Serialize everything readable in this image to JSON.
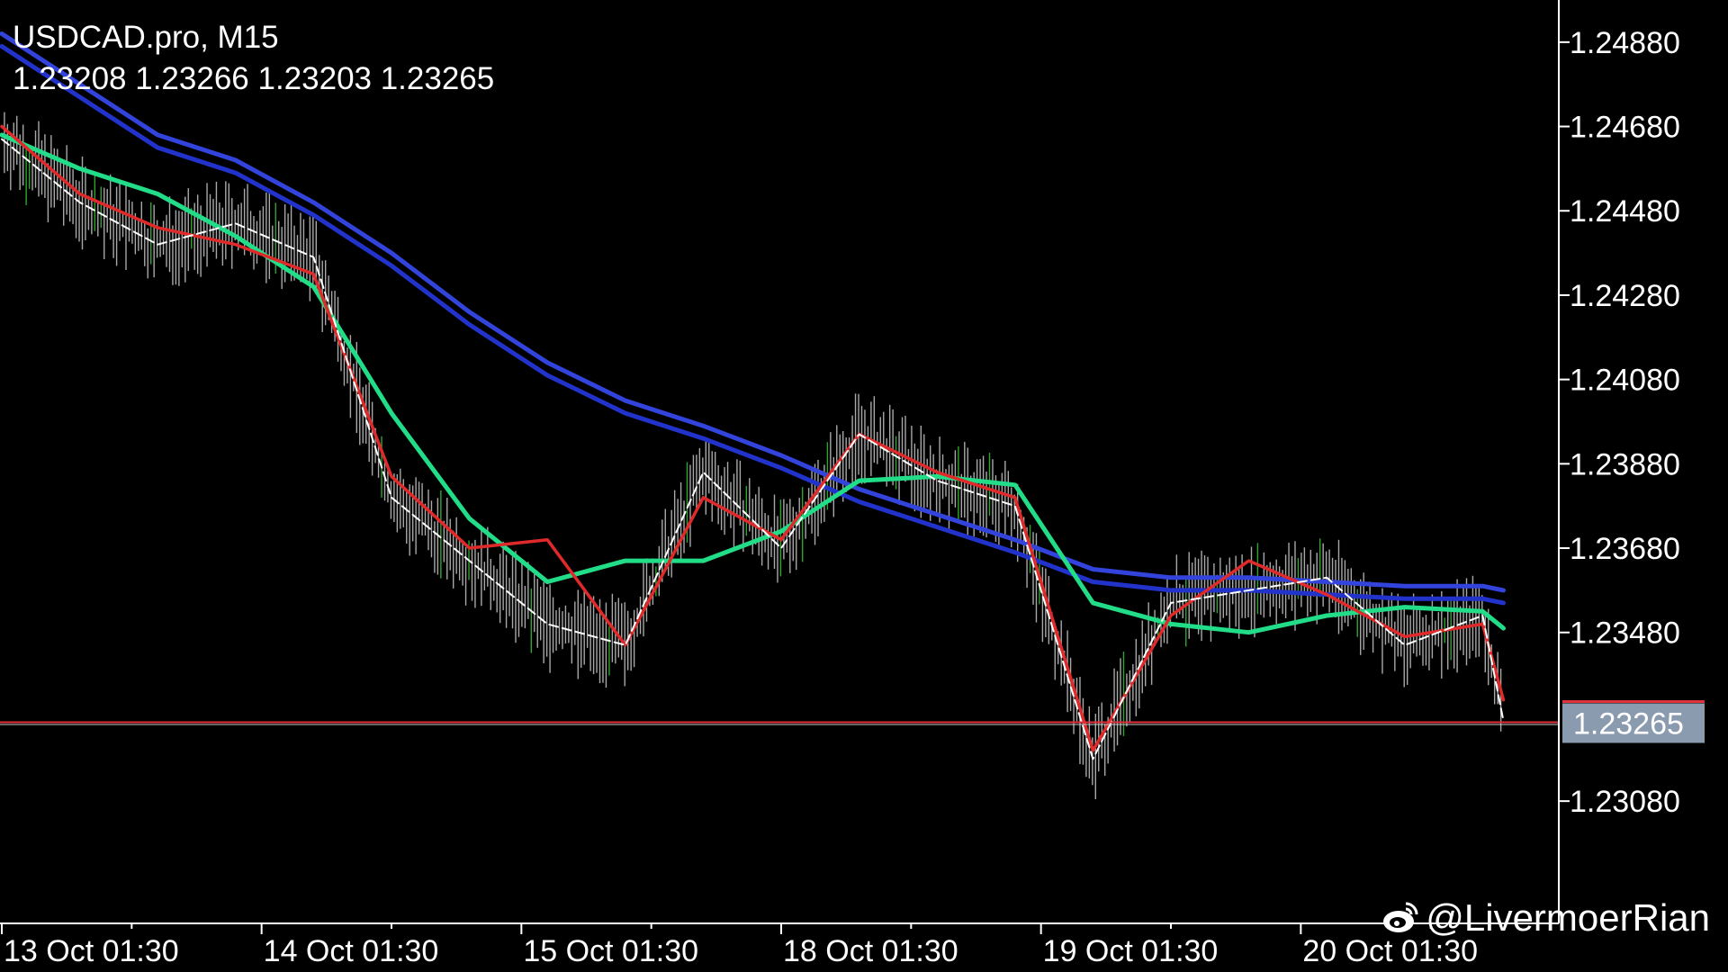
{
  "header": {
    "symbol": "USDCAD.pro, M15",
    "ohlc": "1.23208 1.23266 1.23203 1.23265"
  },
  "watermark": {
    "handle": "@LivermoerRian",
    "icon": "weibo-icon"
  },
  "colors": {
    "background": "#000000",
    "axis": "#ffffff",
    "price_bars": "#a8a8a8",
    "bull_bars": "#2fa52f",
    "ema_fast": "#ffffff",
    "ema_slow": "#e02a2a",
    "ema_mid": "#22dd88",
    "ema_long_upper": "#3344dd",
    "ema_long_lower": "#2233cc",
    "price_line": "#e0303a",
    "price_tag_bg": "#8a9bb0"
  },
  "chart_data": {
    "type": "line",
    "symbol": "USDCAD.pro",
    "timeframe": "M15",
    "x_tick_labels": [
      "13 Oct 01:30",
      "14 Oct 01:30",
      "15 Oct 01:30",
      "18 Oct 01:30",
      "19 Oct 01:30",
      "20 Oct 01:30"
    ],
    "y_tick_labels": [
      "1.24880",
      "1.24680",
      "1.24480",
      "1.24280",
      "1.24080",
      "1.23880",
      "1.23680",
      "1.23480",
      "1.23080"
    ],
    "y_ticks": [
      1.2488,
      1.2468,
      1.2448,
      1.2428,
      1.2408,
      1.2388,
      1.2368,
      1.2348,
      1.2308
    ],
    "ylim": [
      1.2279,
      1.2498
    ],
    "grid": false,
    "current_price": 1.23265,
    "current_price_label": "1.23265",
    "x": [
      0,
      0.3,
      0.6,
      0.9,
      1.2,
      1.5,
      1.8,
      2.1,
      2.4,
      2.7,
      3.0,
      3.3,
      3.6,
      3.9,
      4.2,
      4.5,
      4.8,
      5.1,
      5.4,
      5.7,
      5.78
    ],
    "series": [
      {
        "color": "#ffffff",
        "values": [
          1.2465,
          1.245,
          1.244,
          1.2445,
          1.2437,
          1.238,
          1.2365,
          1.235,
          1.2345,
          1.2386,
          1.2368,
          1.2395,
          1.2384,
          1.2378,
          1.2318,
          1.2355,
          1.2358,
          1.2361,
          1.2345,
          1.2352,
          1.2327
        ]
      },
      {
        "color": "#e02a2a",
        "values": [
          1.2468,
          1.2452,
          1.2444,
          1.244,
          1.2433,
          1.2385,
          1.2368,
          1.237,
          1.2345,
          1.238,
          1.237,
          1.2395,
          1.2386,
          1.238,
          1.232,
          1.2352,
          1.2365,
          1.2357,
          1.2347,
          1.235,
          1.2332
        ]
      },
      {
        "color": "#22dd88",
        "values": [
          1.2466,
          1.2458,
          1.2452,
          1.2442,
          1.243,
          1.24,
          1.2375,
          1.236,
          1.2365,
          1.2365,
          1.2372,
          1.2384,
          1.2385,
          1.2383,
          1.2355,
          1.235,
          1.2348,
          1.2352,
          1.2354,
          1.2353,
          1.2349
        ]
      },
      {
        "color": "#3344dd",
        "values": [
          1.249,
          1.2478,
          1.2466,
          1.246,
          1.245,
          1.2438,
          1.2424,
          1.2412,
          1.2403,
          1.2397,
          1.239,
          1.2382,
          1.2376,
          1.237,
          1.2363,
          1.2361,
          1.2361,
          1.236,
          1.2359,
          1.2359,
          1.2358
        ]
      },
      {
        "color": "#2233cc",
        "values": [
          1.2487,
          1.2475,
          1.2463,
          1.2457,
          1.2447,
          1.2435,
          1.2421,
          1.2409,
          1.24,
          1.2394,
          1.2387,
          1.2379,
          1.2373,
          1.2367,
          1.236,
          1.2358,
          1.2358,
          1.2357,
          1.2356,
          1.2356,
          1.2355
        ]
      }
    ]
  }
}
